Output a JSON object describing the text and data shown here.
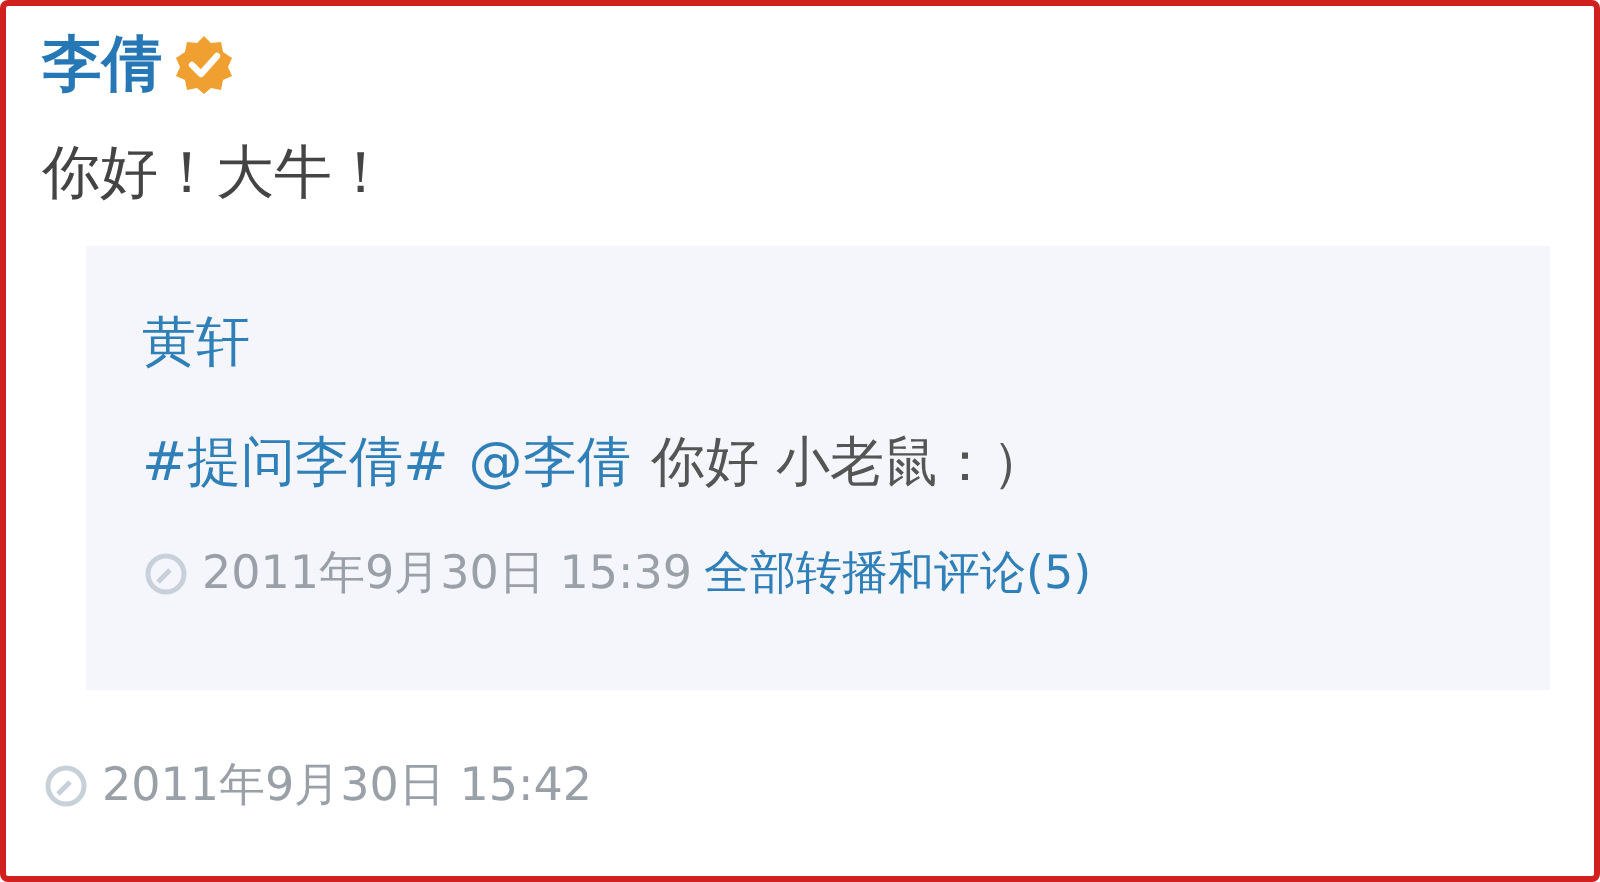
{
  "author": {
    "name": "李倩",
    "verified": true
  },
  "text": "你好！大牛！",
  "repost": {
    "author": "黄轩",
    "content": [
      {
        "kind": "topic",
        "text": "#提问李倩#"
      },
      {
        "kind": "mention",
        "text": "@李倩"
      },
      {
        "kind": "text",
        "text": "你好 小老鼠：）"
      }
    ],
    "time": "2011年9月30日 15:39",
    "link": "全部转播和评论(5)"
  },
  "time": "2011年9月30日 15:42"
}
